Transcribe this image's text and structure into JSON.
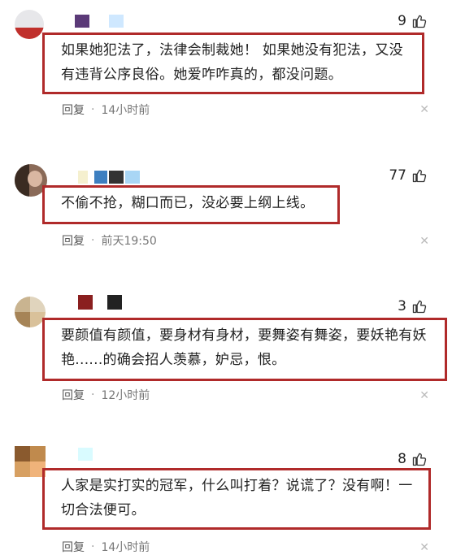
{
  "comments": [
    {
      "likes": "9",
      "text": "如果她犯法了，法律会制裁她！ 如果她没有犯法，又没有违背公序良俗。她爱咋咋真的，都没问题。",
      "reply_label": "回复",
      "separator": "·",
      "time": "14小时前"
    },
    {
      "likes": "77",
      "text": "不偷不抢，糊口而已，没必要上纲上线。",
      "reply_label": "回复",
      "separator": "·",
      "time": "前天19:50"
    },
    {
      "likes": "3",
      "text": "要颜值有颜值，要身材有身材，要舞姿有舞姿，要妖艳有妖艳......的确会招人羡慕，妒忌，恨。",
      "reply_label": "回复",
      "separator": "·",
      "time": "12小时前"
    },
    {
      "likes": "8",
      "text": "人家是实打实的冠军，什么叫打着？说谎了？没有啊！一切合法便可。",
      "reply_label": "回复",
      "separator": "·",
      "time": "14小时前"
    }
  ],
  "icons": {
    "like": "thumbs-up-icon",
    "close": "close-icon"
  },
  "colors": {
    "highlight_border": "#b02a2a",
    "meta_text": "#777777"
  }
}
